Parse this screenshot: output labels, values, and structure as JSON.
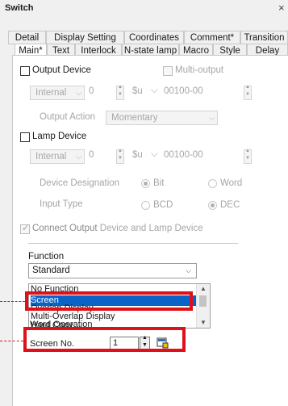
{
  "window": {
    "title": "Switch",
    "close_glyph": "×"
  },
  "tabs_row1": [
    "Detail",
    "Display Setting",
    "Coordinates",
    "Comment*",
    "Transition"
  ],
  "tabs_row2": [
    "Main*",
    "Text",
    "Interlock",
    "N-state lamp",
    "Macro",
    "Style",
    "Delay"
  ],
  "output_device": {
    "label": "Output Device",
    "multi_output_label": "Multi-output",
    "source": "Internal",
    "index": "0",
    "device_type": "$u",
    "address": "00100-00",
    "action_label": "Output Action",
    "action_value": "Momentary"
  },
  "lamp_device": {
    "label": "Lamp Device",
    "source": "Internal",
    "index": "0",
    "device_type": "$u",
    "address": "00100-00",
    "designation_label": "Device Designation",
    "designation_options": [
      "Bit",
      "Word"
    ],
    "input_type_label": "Input Type",
    "input_type_options": [
      "BCD",
      "DEC"
    ]
  },
  "connect": {
    "label_a": "Connect Output",
    "label_b": " Device and Lamp Device"
  },
  "function": {
    "label": "Function",
    "selected": "Standard",
    "options": [
      "No Function",
      "Screen",
      "Overlap Display",
      "Multi-Overlap Display",
      "Hard Copy",
      "Word Operation"
    ],
    "selected_option": "Screen"
  },
  "screen_no": {
    "label": "Screen No.",
    "value": "1"
  },
  "colors": {
    "highlight": "#e0101a",
    "selection": "#0a64c8"
  }
}
